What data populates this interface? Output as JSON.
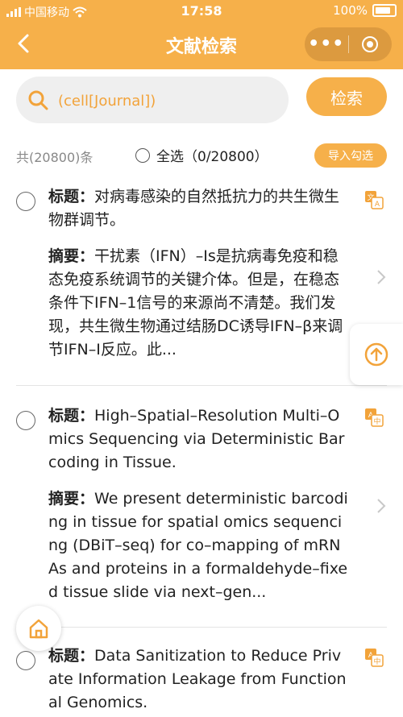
{
  "status_bar": {
    "carrier": "中国移动",
    "time": "17:58",
    "battery": "100%"
  },
  "nav": {
    "title": "文献检索"
  },
  "search": {
    "value": "(cell[Journal])",
    "button_label": "检索"
  },
  "results_bar": {
    "count_text": "共(20800)条",
    "select_all_label": "全选（0/20800）",
    "import_label": "导入勾选"
  },
  "results": [
    {
      "title_label": "标题：",
      "title": "对病毒感染的自然抵抗力的共生微生物群调节。",
      "abstract_label": "摘要：",
      "abstract": "干扰素（IFN）–Is是抗病毒免疫和稳态免疫系统调节的关键介体。但是，在稳态条件下IFN–1信号的来源尚不清楚。我们发现，共生微生物通过结肠DC诱导IFN–β来调节IFN–I反应。此..."
    },
    {
      "title_label": "标题：",
      "title": "High–Spatial–Resolution Multi–Omics Sequencing via Deterministic Barcoding in Tissue.",
      "abstract_label": "摘要：",
      "abstract": "We present deterministic barcoding in tissue for spatial omics sequencing (DBiT–seq) for co–mapping of mRNAs and proteins in a formaldehyde–fixed tissue slide via next–gen..."
    },
    {
      "title_label": "标题：",
      "title": "Data Sanitization to Reduce Private Information Leakage from Functional Genomics."
    }
  ],
  "colors": {
    "accent": "#f6b04a",
    "query_text": "#f2a33a"
  }
}
